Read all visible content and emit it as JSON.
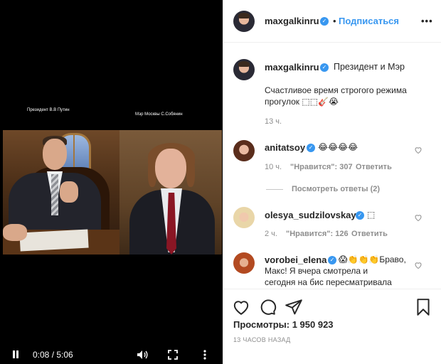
{
  "video": {
    "caption_left": "Президент В.В Путин",
    "caption_right": "Мэр Москвы С.Собянин",
    "time": "0:08 / 5:06"
  },
  "header": {
    "username": "maxgalkinru",
    "separator": "•",
    "follow_label": "Подписаться",
    "options_label": "•••"
  },
  "post": {
    "username": "maxgalkinru",
    "title": "Президент и Мэр",
    "body_line1": "Счастливое время строгого режима",
    "body_line2": "прогулок ⬚⬚🎸😭",
    "time": "13 ч."
  },
  "comments": [
    {
      "username": "anitatsoy",
      "text": "😂😂😂😂",
      "time": "10 ч.",
      "likes": "\"Нравится\": 307",
      "reply": "Ответить",
      "view_replies": "Посмотреть ответы (2)"
    },
    {
      "username": "olesya_sudzilovskaya",
      "text": "⬚",
      "time": "2 ч.",
      "likes": "\"Нравится\": 126",
      "reply": "Ответить"
    },
    {
      "username": "vorobei_elena",
      "text_line1": "😱👏👏👏Браво,",
      "text_line2": "Макс! Я вчера смотрела и",
      "text_line3": "сегодня на бис пересматривала"
    }
  ],
  "footer": {
    "views": "Просмотры: 1 950 923",
    "posted": "13 ЧАСОВ НАЗАД"
  },
  "colors": {
    "accent": "#3897f0",
    "muted": "#8e8e8e",
    "text": "#262626"
  }
}
